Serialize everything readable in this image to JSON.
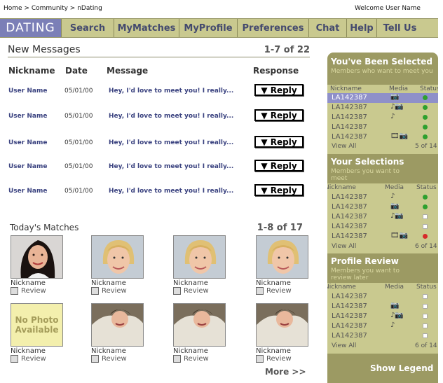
{
  "breadcrumb": "Home > Community > nDating",
  "welcome": "Welcome User Name",
  "nav": [
    "DATING",
    "Search",
    "MyMatches",
    "MyProfile",
    "Preferences",
    "Chat",
    "Help",
    "Tell Us"
  ],
  "messages": {
    "title": "New Messages",
    "count": "1-7 of 22",
    "columns": [
      "Nickname",
      "Date",
      "Message",
      "Response"
    ],
    "rows": [
      {
        "nick": "User Name",
        "date": "05/01/00",
        "text": "Hey, I'd love to meet you!  I really...",
        "reply": "▼ Reply"
      },
      {
        "nick": "User Name",
        "date": "05/01/00",
        "text": "Hey, I'd love to meet you!  I really...",
        "reply": "▼ Reply"
      },
      {
        "nick": "User Name",
        "date": "05/01/00",
        "text": "Hey, I'd love to meet you!  I really...",
        "reply": "▼ Reply"
      },
      {
        "nick": "User Name",
        "date": "05/01/00",
        "text": "Hey, I'd love to meet you!  I really...",
        "reply": "▼ Reply"
      },
      {
        "nick": "User Name",
        "date": "05/01/00",
        "text": "Hey, I'd love to meet you!  I really...",
        "reply": "▼ Reply"
      }
    ]
  },
  "matches": {
    "title": "Today's Matches",
    "count": "1-8 of 17",
    "no_photo": "No Photo Available",
    "items": [
      {
        "nick": "Nickname",
        "review": "Review"
      },
      {
        "nick": "Nickname",
        "review": "Review"
      },
      {
        "nick": "Nickname",
        "review": "Review"
      },
      {
        "nick": "Nickname",
        "review": "Review"
      },
      {
        "nick": "Nickname",
        "review": "Review"
      },
      {
        "nick": "Nickname",
        "review": "Review"
      },
      {
        "nick": "Nickname",
        "review": "Review"
      },
      {
        "nick": "Nickname",
        "review": "Review"
      }
    ],
    "more": "More >>"
  },
  "sidebar": {
    "columns": [
      "Nickname",
      "Media",
      "Status"
    ],
    "panels": [
      {
        "title": "You've Been Selected",
        "subtitle": [
          "Members who want to meet you"
        ],
        "rows": [
          {
            "id": "LA142387",
            "media": "📷",
            "status": "green"
          },
          {
            "id": "LA142387",
            "media": "♪📷",
            "status": "green"
          },
          {
            "id": "LA142387",
            "media": "♪",
            "status": "green"
          },
          {
            "id": "LA142387",
            "media": "",
            "status": "green"
          },
          {
            "id": "LA142387",
            "media": "🎞📷",
            "status": "green"
          }
        ],
        "view_all": "View All",
        "count": "5 of 14"
      },
      {
        "title": "Your Selections",
        "subtitle": [
          "Members you want to",
          "meet"
        ],
        "rows": [
          {
            "id": "LA142387",
            "media": "♪",
            "status": "green"
          },
          {
            "id": "LA142387",
            "media": "📷",
            "status": "green"
          },
          {
            "id": "LA142387",
            "media": "♪📷",
            "status": "empty"
          },
          {
            "id": "LA142387",
            "media": "",
            "status": "empty"
          },
          {
            "id": "LA142387",
            "media": "🎞📷",
            "status": "red"
          }
        ],
        "view_all": "View All",
        "count": "6 of 14"
      },
      {
        "title": "Profile Review",
        "subtitle": [
          "Members you want to",
          "review later"
        ],
        "rows": [
          {
            "id": "LA142387",
            "media": "",
            "status": "empty"
          },
          {
            "id": "LA142387",
            "media": "📷",
            "status": "empty"
          },
          {
            "id": "LA142387",
            "media": "♪📷",
            "status": "empty"
          },
          {
            "id": "LA142387",
            "media": "♪",
            "status": "empty"
          },
          {
            "id": "LA142387",
            "media": "",
            "status": "empty"
          }
        ],
        "view_all": "View All",
        "count": "6 of 14"
      }
    ],
    "show_legend": "Show Legend"
  }
}
